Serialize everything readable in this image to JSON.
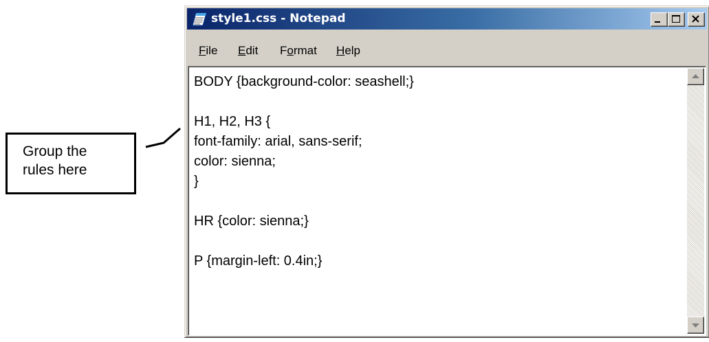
{
  "callout": {
    "lines": [
      "Group the",
      "rules here"
    ]
  },
  "window": {
    "title": "style1.css - Notepad",
    "icon": "notepad-icon",
    "titlebar_color": "#0a246a",
    "controls": [
      "minimize-icon",
      "maximize-icon",
      "close-icon"
    ]
  },
  "menu": {
    "file": {
      "access_key": "F",
      "rest": "ile"
    },
    "edit": {
      "access_key": "E",
      "rest": "dit"
    },
    "format": {
      "prefix": "F",
      "access_key": "o",
      "rest": "rmat"
    },
    "help": {
      "access_key": "H",
      "rest": "elp"
    }
  },
  "editor": {
    "lines": [
      "BODY {background-color: seashell;}",
      "",
      "H1, H2, H3 {",
      "font-family: arial, sans-serif;",
      "color: sienna;",
      "}",
      "",
      "HR {color: sienna;}",
      "",
      "P {margin-left: 0.4in;}"
    ]
  },
  "scrollbar": {
    "up_icon": "scroll-up-arrow-icon",
    "down_icon": "scroll-down-arrow-icon"
  }
}
